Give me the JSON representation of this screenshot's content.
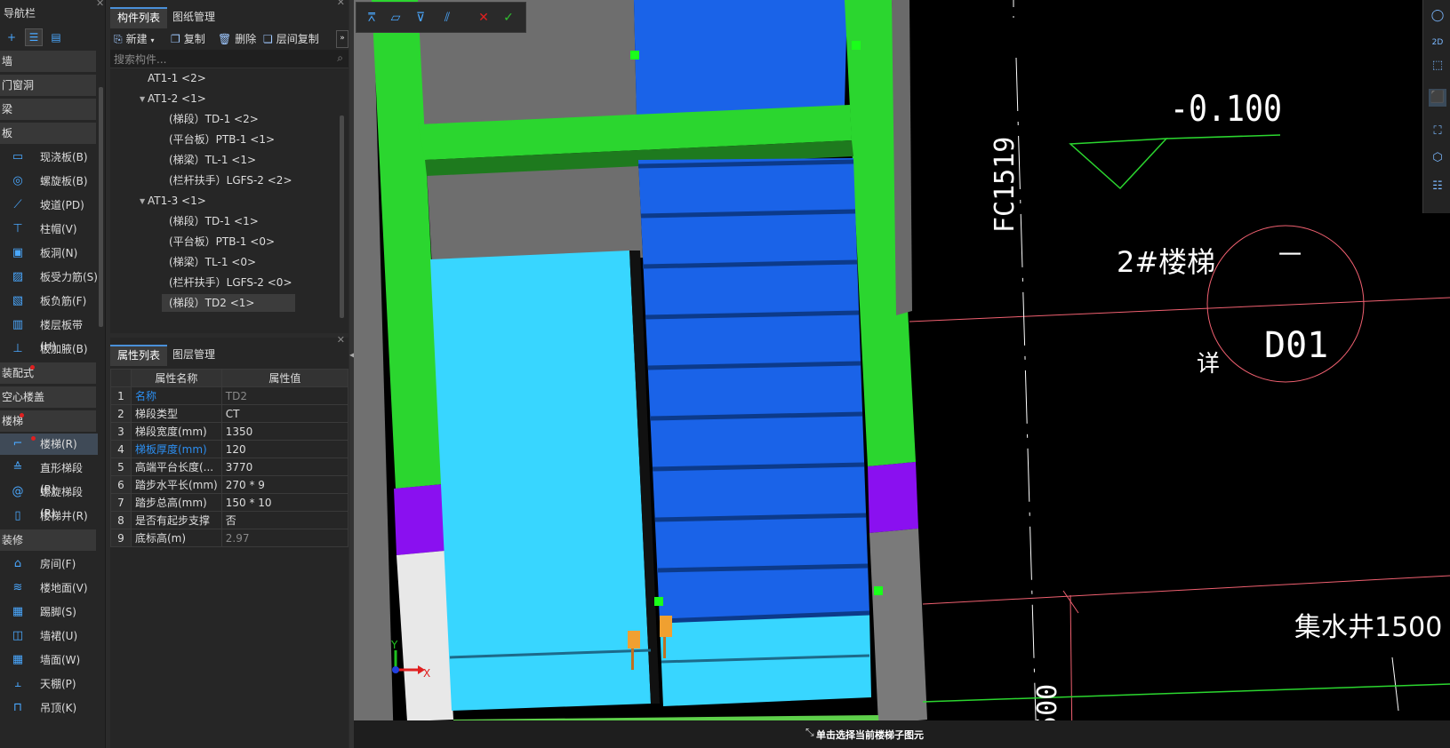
{
  "nav": {
    "title": "导航栏",
    "categories": [
      "墙",
      "门窗洞",
      "梁",
      "板",
      "装配式",
      "空心楼盖",
      "楼梯",
      "装修"
    ],
    "board_items": [
      {
        "label": "现浇板(B)",
        "icon": "slab-icon"
      },
      {
        "label": "螺旋板(B)",
        "icon": "spiral-slab-icon"
      },
      {
        "label": "坡道(PD)",
        "icon": "ramp-icon"
      },
      {
        "label": "柱帽(V)",
        "icon": "column-cap-icon"
      },
      {
        "label": "板洞(N)",
        "icon": "slab-hole-icon"
      },
      {
        "label": "板受力筋(S)",
        "icon": "slab-rebar-icon"
      },
      {
        "label": "板负筋(F)",
        "icon": "negative-rebar-icon"
      },
      {
        "label": "楼层板带(H)",
        "icon": "slab-strip-icon"
      },
      {
        "label": "板加腋(B)",
        "icon": "haunch-icon"
      }
    ],
    "stair_items": [
      {
        "label": "楼梯(R)",
        "icon": "stair-icon"
      },
      {
        "label": "直形梯段(R)",
        "icon": "straight-flight-icon"
      },
      {
        "label": "螺旋梯段(R)",
        "icon": "spiral-flight-icon"
      },
      {
        "label": "楼梯井(R)",
        "icon": "stairwell-icon"
      }
    ],
    "finish_items": [
      {
        "label": "房间(F)",
        "icon": "room-icon"
      },
      {
        "label": "楼地面(V)",
        "icon": "floor-icon"
      },
      {
        "label": "踢脚(S)",
        "icon": "skirting-icon"
      },
      {
        "label": "墙裙(U)",
        "icon": "dado-icon"
      },
      {
        "label": "墙面(W)",
        "icon": "wall-face-icon"
      },
      {
        "label": "天棚(P)",
        "icon": "ceiling-icon"
      },
      {
        "label": "吊顶(K)",
        "icon": "suspended-ceiling-icon"
      }
    ]
  },
  "component_panel": {
    "tabs": [
      "构件列表",
      "图纸管理"
    ],
    "toolbar": {
      "new": "新建",
      "copy": "复制",
      "delete": "删除",
      "floor_copy": "层间复制"
    },
    "search_placeholder": "搜索构件...",
    "tree": [
      "AT1-1 <2>",
      "AT1-2 <1>",
      "(梯段）TD-1 <2>",
      "(平台板）PTB-1 <1>",
      "(梯梁）TL-1 <1>",
      "(栏杆扶手）LGFS-2 <2>",
      "AT1-3 <1>",
      "(梯段）TD-1 <1>",
      "(平台板）PTB-1 <0>",
      "(梯梁）TL-1 <0>",
      "(栏杆扶手）LGFS-2 <0>",
      "(梯段）TD2 <1>"
    ]
  },
  "property_panel": {
    "tabs": [
      "属性列表",
      "图层管理"
    ],
    "headers": [
      "属性名称",
      "属性值"
    ],
    "rows": [
      {
        "n": "1",
        "name": "名称",
        "value": "TD2"
      },
      {
        "n": "2",
        "name": "梯段类型",
        "value": "CT"
      },
      {
        "n": "3",
        "name": "梯段宽度(mm)",
        "value": "1350"
      },
      {
        "n": "4",
        "name": "梯板厚度(mm)",
        "value": "120"
      },
      {
        "n": "5",
        "name": "高端平台长度(...",
        "value": "3770"
      },
      {
        "n": "6",
        "name": "踏步水平长(mm)",
        "value": "270 * 9"
      },
      {
        "n": "7",
        "name": "踏步总高(mm)",
        "value": "150 * 10"
      },
      {
        "n": "8",
        "name": "是否有起步支撑",
        "value": "否"
      },
      {
        "n": "9",
        "name": "底标高(m)",
        "value": "2.97"
      }
    ]
  },
  "viewport": {
    "cad_texts": {
      "elevation": "-0.100",
      "stair_label": "2#楼梯",
      "detail_ref": "D01",
      "detail_char": "详",
      "circle_top": "一",
      "window": "FC1519",
      "sump": "集水井1500",
      "dim": "1500"
    },
    "axis_x": "X",
    "axis_y": "Y"
  },
  "status_bar": {
    "message": "单击选择当前楼梯子图元"
  },
  "colors": {
    "green": "#2bd62f",
    "dark_green": "#1e7a1e",
    "blue": "#1a63e8",
    "light_blue": "#38d6ff",
    "purple": "#8a10f0",
    "gray": "#7a7a7a",
    "accent": "#4a90d9"
  }
}
